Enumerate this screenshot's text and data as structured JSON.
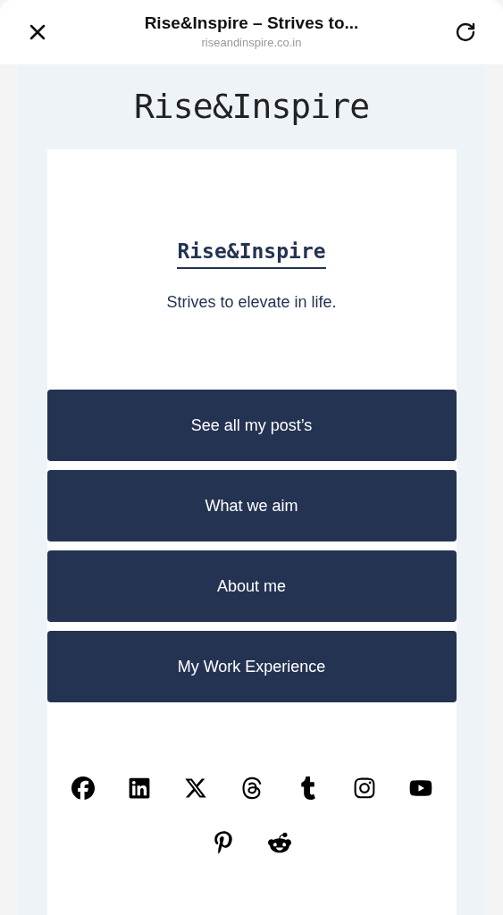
{
  "browser_bar": {
    "title": "Rise&Inspire – Strives to...",
    "url": "riseandinspire.co.in"
  },
  "site_header": {
    "title": "Rise&Inspire"
  },
  "card": {
    "logo": "Rise&Inspire",
    "tagline": "Strives to elevate in life.",
    "buttons": [
      "See all my post’s",
      "What we aim",
      "About me",
      "My Work Experience"
    ],
    "social_rows": [
      [
        {
          "kind": "facebook"
        },
        {
          "kind": "linkedin"
        },
        {
          "kind": "x"
        },
        {
          "kind": "threads"
        },
        {
          "kind": "tumblr"
        },
        {
          "kind": "instagram"
        },
        {
          "kind": "youtube"
        }
      ],
      [
        {
          "kind": "pinterest"
        },
        {
          "kind": "reddit"
        }
      ]
    ]
  }
}
